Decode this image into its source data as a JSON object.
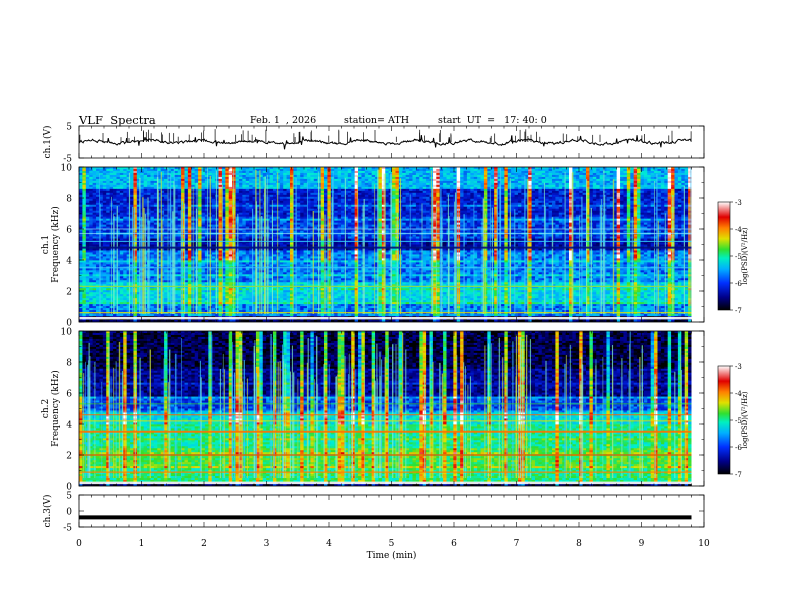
{
  "header": {
    "title": "VLF  Spectra",
    "date": "Feb. 1  , 2026",
    "station": "station= ATH",
    "start": "start  UT  =   17: 40: 0"
  },
  "chart_data": [
    {
      "type": "line",
      "panel": "ch1-waveform",
      "ylabel": "ch.1(V)",
      "ylim": [
        -5,
        5
      ],
      "y_ticks": [
        "5",
        "-5"
      ],
      "xlim": [
        0,
        10
      ],
      "baseline": 0,
      "description_values": {
        "mean_v": 0.0,
        "approx_range_v": [
          -0.8,
          0.8
        ]
      }
    },
    {
      "type": "heatmap",
      "panel": "ch1-spectrogram",
      "ylabel": "ch.1\nFrequency  (kHz)",
      "ylim": [
        0,
        10
      ],
      "y_ticks": [
        "0",
        "2",
        "4",
        "6",
        "8",
        "10"
      ],
      "xlim": [
        0,
        10
      ],
      "data_end_min": 9.8,
      "colorbar": {
        "label": "log(PSD)(V²/Hz)",
        "range": [
          -7,
          -3
        ],
        "ticks": [
          "-3",
          "-4",
          "-5",
          "-6",
          "-7"
        ]
      }
    },
    {
      "type": "heatmap",
      "panel": "ch2-spectrogram",
      "ylabel": "ch.2\nFrequency  (kHz)",
      "ylim": [
        0,
        10
      ],
      "y_ticks": [
        "0",
        "2",
        "4",
        "6",
        "8",
        "10"
      ],
      "xlim": [
        0,
        10
      ],
      "data_end_min": 9.8,
      "colorbar": {
        "label": "log(PSD)(V²/Hz)",
        "range": [
          -7,
          -3
        ],
        "ticks": [
          "-3",
          "-4",
          "-5",
          "-6",
          "-7"
        ]
      }
    },
    {
      "type": "line",
      "panel": "ch3-waveform",
      "ylabel": "ch.3(V)",
      "ylim": [
        -5,
        5
      ],
      "y_ticks": [
        "5",
        "0",
        "-5"
      ],
      "xlim": [
        0,
        10
      ],
      "baseline": -2,
      "x_ticks": [
        "0",
        "1",
        "2",
        "3",
        "4",
        "5",
        "6",
        "7",
        "8",
        "9",
        "10"
      ],
      "xlabel": "Time  (min)"
    }
  ],
  "colors": {
    "cmap": [
      "#000000",
      "#00008b",
      "#0020e0",
      "#00a8ff",
      "#00f0d0",
      "#30e030",
      "#e0e000",
      "#ff8000",
      "#e00000",
      "#ffffff"
    ]
  }
}
